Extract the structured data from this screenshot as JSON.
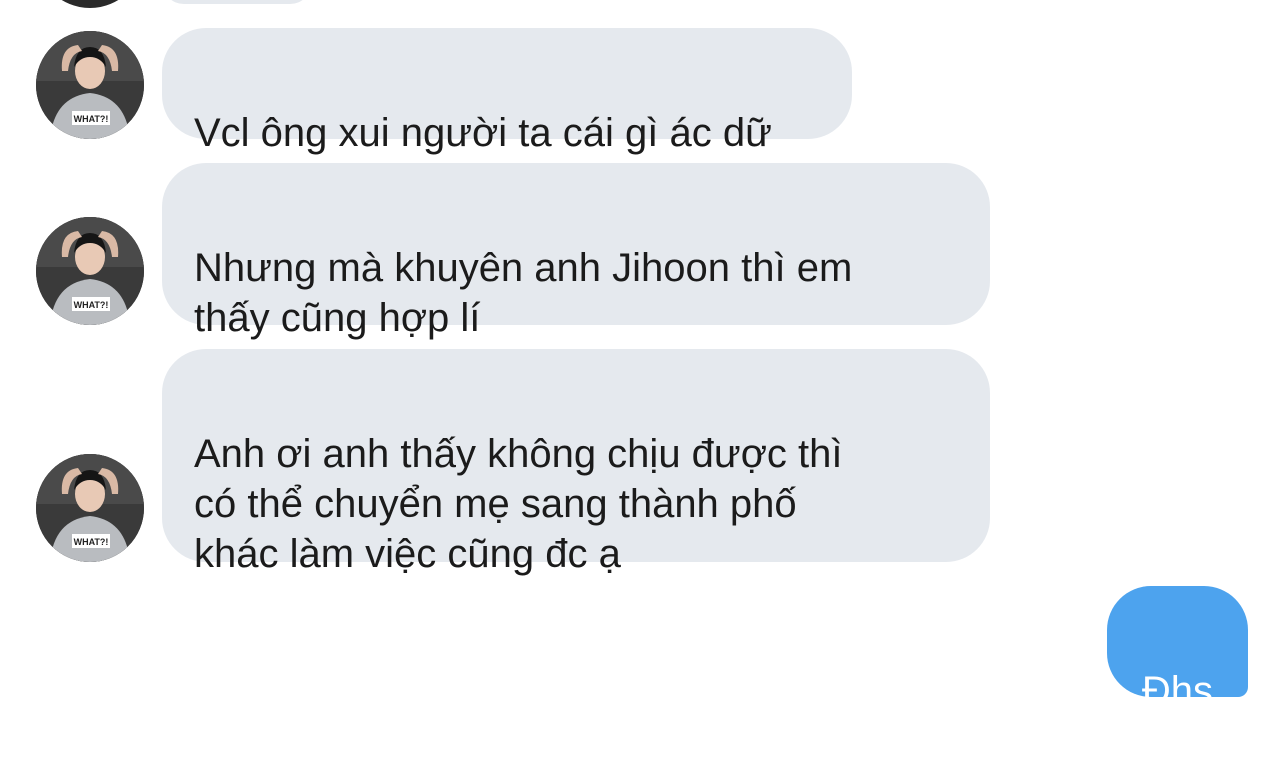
{
  "colors": {
    "incoming_bubble": "#e5e9ee",
    "outgoing_bubble": "#4da3ee",
    "incoming_text": "#1b1b1b",
    "outgoing_text": "#ffffff"
  },
  "messages": [
    {
      "direction": "incoming",
      "avatar": "contact-avatar",
      "text": "Vcl ông xui người ta cái gì ác dữ"
    },
    {
      "direction": "incoming",
      "avatar": "contact-avatar",
      "text": "Nhưng mà khuyên anh Jihoon thì em\nthấy cũng hợp lí"
    },
    {
      "direction": "incoming",
      "avatar": "contact-avatar",
      "text": "Anh ơi anh thấy không chịu được thì\ncó thể chuyển mẹ sang thành phố\nkhác làm việc cũng đc ạ"
    },
    {
      "direction": "outgoing",
      "text": "Đhs"
    }
  ]
}
